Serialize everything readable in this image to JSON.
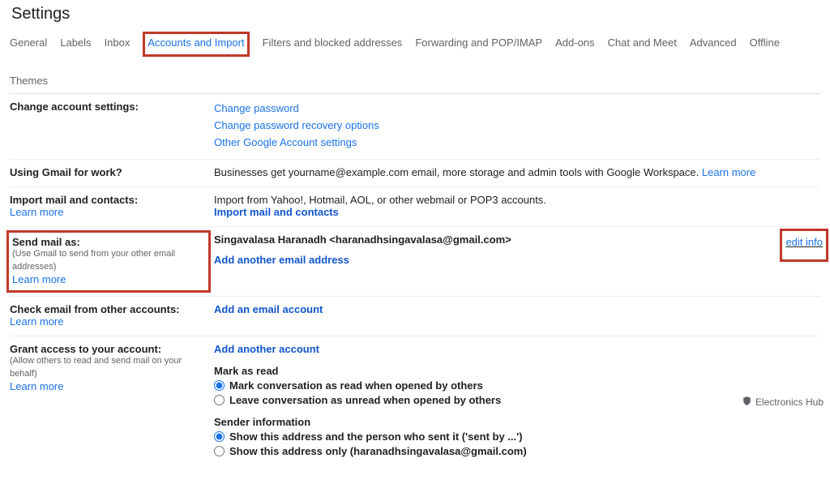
{
  "title": "Settings",
  "tabs": [
    {
      "label": "General"
    },
    {
      "label": "Labels"
    },
    {
      "label": "Inbox"
    },
    {
      "label": "Accounts and Import",
      "active": true,
      "highlight": true
    },
    {
      "label": "Filters and blocked addresses"
    },
    {
      "label": "Forwarding and POP/IMAP"
    },
    {
      "label": "Add-ons"
    },
    {
      "label": "Chat and Meet"
    },
    {
      "label": "Advanced"
    },
    {
      "label": "Offline"
    },
    {
      "label": "Themes"
    }
  ],
  "change_account": {
    "heading": "Change account settings:",
    "links": {
      "pw": "Change password",
      "recovery": "Change password recovery options",
      "other": "Other Google Account settings"
    }
  },
  "work": {
    "heading": "Using Gmail for work?",
    "body": "Businesses get yourname@example.com email, more storage and admin tools with Google Workspace. ",
    "learn": "Learn more"
  },
  "import": {
    "heading": "Import mail and contacts:",
    "learn": "Learn more",
    "body": "Import from Yahoo!, Hotmail, AOL, or other webmail or POP3 accounts.",
    "action": "Import mail and contacts"
  },
  "sendmail": {
    "heading": "Send mail as:",
    "sub": "(Use Gmail to send from your other email addresses)",
    "learn": "Learn more",
    "identity": "Singavalasa Haranadh <haranadhsingavalasa@gmail.com>",
    "add": "Add another email address",
    "edit": "edit info"
  },
  "check": {
    "heading": "Check email from other accounts:",
    "learn": "Learn more",
    "add": "Add an email account"
  },
  "grant": {
    "heading": "Grant access to your account:",
    "sub": "(Allow others to read and send mail on your behalf)",
    "learn": "Learn more",
    "add": "Add another account",
    "mark_head": "Mark as read",
    "mark_opt1": "Mark conversation as read when opened by others",
    "mark_opt2": "Leave conversation as unread when opened by others",
    "sender_head": "Sender information",
    "sender_opt1": "Show this address and the person who sent it ('sent by ...')",
    "sender_opt2": "Show this address only (haranadhsingavalasa@gmail.com)"
  },
  "brand": "Electronics Hub"
}
